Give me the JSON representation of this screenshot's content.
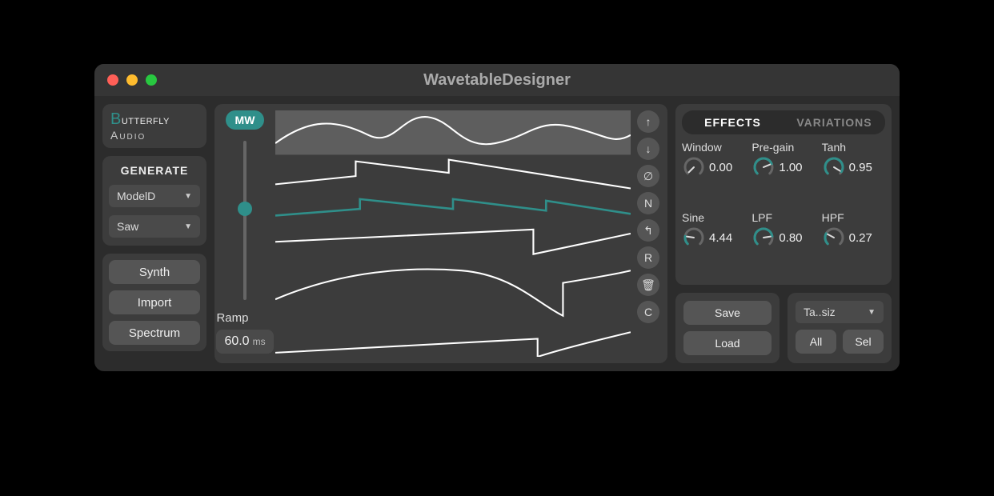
{
  "window": {
    "title": "WavetableDesigner"
  },
  "brand": {
    "line1": "Butterfly",
    "line2": "Audio"
  },
  "generate": {
    "label": "GENERATE",
    "model": "ModelD",
    "wave": "Saw"
  },
  "left_buttons": {
    "synth": "Synth",
    "import": "Import",
    "spectrum": "Spectrum"
  },
  "mw": {
    "label": "MW"
  },
  "ramp": {
    "label": "Ramp",
    "value": "60.0",
    "unit": "ms"
  },
  "wave_buttons": {
    "up": "↑",
    "down": "↓",
    "phase": "∅",
    "norm": "N",
    "rev": "↰",
    "rand": "R",
    "del": "🗑",
    "copy": "C"
  },
  "tabs": {
    "effects": "EFFECTS",
    "variations": "VARIATIONS"
  },
  "knobs": {
    "window": {
      "label": "Window",
      "value": "0.00",
      "frac": 0.0
    },
    "pregain": {
      "label": "Pre-gain",
      "value": "1.00",
      "frac": 0.75
    },
    "tanh": {
      "label": "Tanh",
      "value": "0.95",
      "frac": 0.95
    },
    "sine": {
      "label": "Sine",
      "value": "4.44",
      "frac": 0.2
    },
    "lpf": {
      "label": "LPF",
      "value": "0.80",
      "frac": 0.8
    },
    "hpf": {
      "label": "HPF",
      "value": "0.27",
      "frac": 0.27
    }
  },
  "save": {
    "save": "Save",
    "load": "Load"
  },
  "export": {
    "preset": "Ta..siz",
    "all": "All",
    "sel": "Sel"
  },
  "colors": {
    "accent": "#2f8f8a"
  }
}
